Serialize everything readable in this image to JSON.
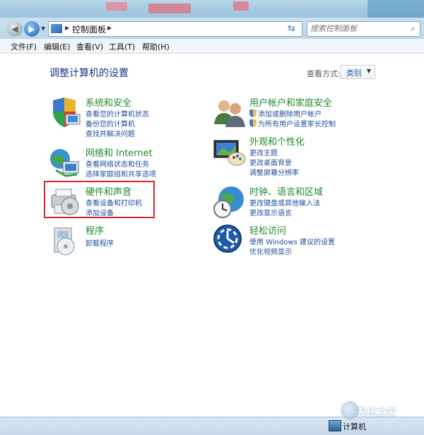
{
  "address": {
    "crumb": "控制面板",
    "search_placeholder": "搜索控制面板"
  },
  "menu": [
    {
      "label": "文件(F)"
    },
    {
      "label": "编辑(E)"
    },
    {
      "label": "查看(V)"
    },
    {
      "label": "工具(T)"
    },
    {
      "label": "帮助(H)"
    }
  ],
  "main": {
    "title": "调整计算机的设置",
    "view_by_label": "查看方式:",
    "view_by_value": "类别"
  },
  "categories": {
    "system": {
      "title": "系统和安全",
      "links": [
        "查看您的计算机状态",
        "备份您的计算机",
        "查找并解决问题"
      ]
    },
    "network": {
      "title": "网络和 Internet",
      "links": [
        "查看网络状态和任务",
        "选择家庭组和共享选项"
      ]
    },
    "hardware": {
      "title": "硬件和声音",
      "links": [
        "查看设备和打印机",
        "添加设备"
      ]
    },
    "programs": {
      "title": "程序",
      "links": [
        "卸载程序"
      ]
    },
    "users": {
      "title": "用户帐户和家庭安全",
      "links": [
        "添加或删除用户帐户",
        "为所有用户设置家长控制"
      ]
    },
    "appearance": {
      "title": "外观和个性化",
      "links": [
        "更改主题",
        "更改桌面背景",
        "调整屏幕分辨率"
      ]
    },
    "clock": {
      "title": "时钟、语言和区域",
      "links": [
        "更改键盘或其他输入法",
        "更改显示语言"
      ]
    },
    "ease": {
      "title": "轻松访问",
      "links": [
        "使用 Windows 建议的设置",
        "优化视频显示"
      ]
    }
  },
  "status": {
    "computer_label": "计算机"
  },
  "watermark": "系统之家",
  "colors": {
    "category_title": "#1e8a2b",
    "link": "#1f4e9c",
    "page_title": "#1e3287",
    "highlight": "#d9262c"
  }
}
